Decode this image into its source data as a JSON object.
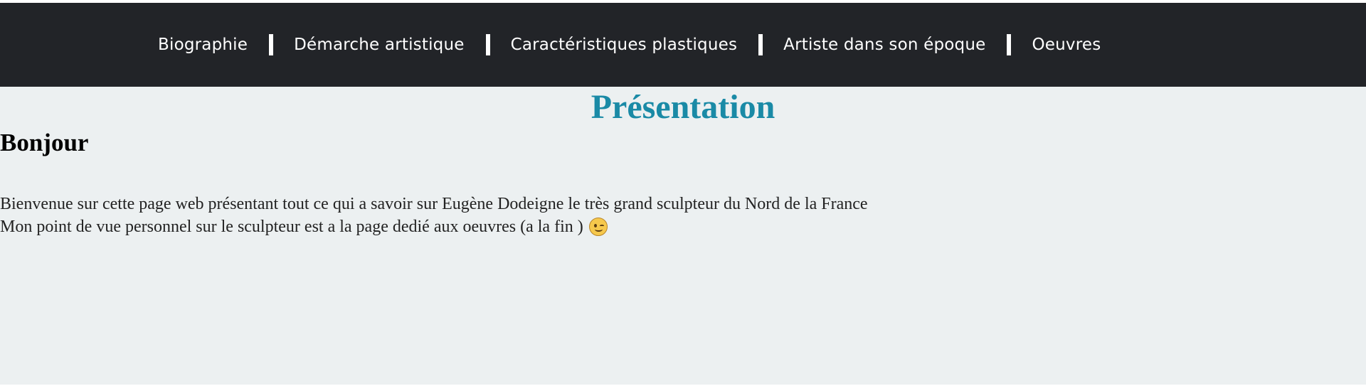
{
  "nav": {
    "items": [
      {
        "label": "Biographie"
      },
      {
        "label": "Démarche artistique"
      },
      {
        "label": "Caractéristiques plastiques"
      },
      {
        "label": "Artiste dans son époque"
      },
      {
        "label": "Oeuvres"
      }
    ]
  },
  "main": {
    "title": "Présentation",
    "greeting": "Bonjour",
    "paragraph_1": "Bienvenue sur cette page web présentant tout ce qui a savoir sur Eugène Dodeigne le très grand sculpteur du Nord de la France",
    "paragraph_2": "Mon point de vue personnel sur le sculpteur est a la page dedié aux oeuvres (a la fin )",
    "emoji_icon": "winking-face-icon"
  },
  "colors": {
    "navbar_bg": "#222428",
    "page_bg": "#ecf0f1",
    "title_color": "#1a8aa6"
  }
}
